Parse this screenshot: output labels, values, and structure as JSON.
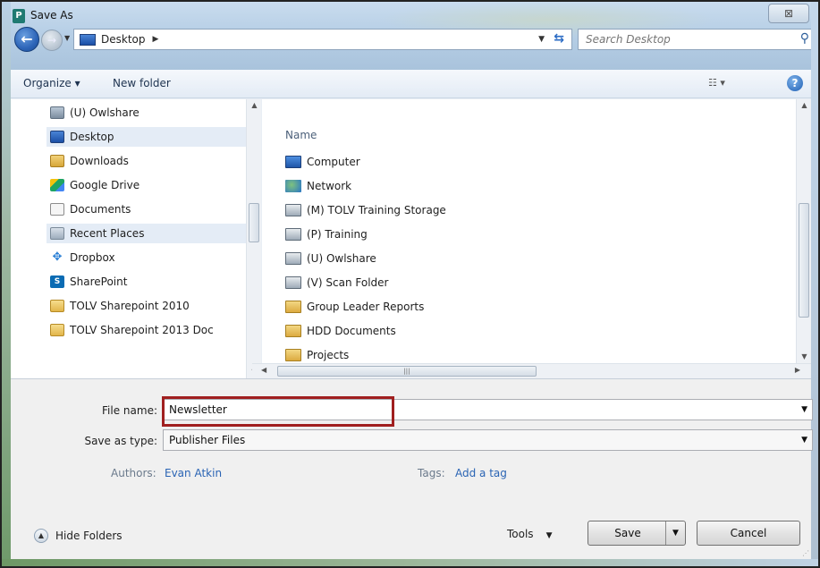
{
  "window": {
    "title": "Save As",
    "app_icon": "publisher-icon",
    "close_glyph": "⊠"
  },
  "nav": {
    "location": "Desktop",
    "search_placeholder": "Search Desktop"
  },
  "toolbar": {
    "organize_label": "Organize ▾",
    "new_folder_label": "New folder",
    "views_glyph": "▾",
    "help_glyph": "?"
  },
  "sidebar": {
    "items": [
      {
        "label": "(U) Owlshare",
        "icon": "network-drive-icon"
      },
      {
        "label": "Desktop",
        "icon": "desktop-icon",
        "selected": true
      },
      {
        "label": "Downloads",
        "icon": "downloads-icon"
      },
      {
        "label": "Google Drive",
        "icon": "google-drive-icon"
      },
      {
        "label": "Documents",
        "icon": "documents-icon"
      },
      {
        "label": "Recent Places",
        "icon": "recent-places-icon"
      },
      {
        "label": "Dropbox",
        "icon": "dropbox-icon"
      },
      {
        "label": "SharePoint",
        "icon": "sharepoint-icon"
      },
      {
        "label": "TOLV Sharepoint 2010",
        "icon": "folder-icon"
      },
      {
        "label": "TOLV Sharepoint 2013 Doc",
        "icon": "folder-icon"
      }
    ]
  },
  "files": {
    "column_header": "Name",
    "items": [
      {
        "label": "Computer",
        "icon": "computer-icon"
      },
      {
        "label": "Network",
        "icon": "network-icon"
      },
      {
        "label": "(M) TOLV Training Storage",
        "icon": "network-drive-icon"
      },
      {
        "label": "(P) Training",
        "icon": "network-drive-icon"
      },
      {
        "label": "(U) Owlshare",
        "icon": "network-drive-icon"
      },
      {
        "label": "(V) Scan Folder",
        "icon": "network-drive-icon"
      },
      {
        "label": "Group Leader Reports",
        "icon": "shortcut-folder-icon"
      },
      {
        "label": "HDD Documents",
        "icon": "shortcut-folder-icon"
      },
      {
        "label": "Projects",
        "icon": "shortcut-folder-icon"
      }
    ]
  },
  "form": {
    "file_name_label": "File name:",
    "file_name_value": "Newsletter",
    "save_type_label": "Save as type:",
    "save_type_value": "Publisher Files",
    "authors_label": "Authors:",
    "authors_value": "Evan Atkin",
    "tags_label": "Tags:",
    "tags_value": "Add a tag"
  },
  "footer": {
    "hide_folders_label": "Hide Folders",
    "tools_label": "Tools",
    "save_label": "Save",
    "cancel_label": "Cancel"
  },
  "colors": {
    "highlight_box": "#a01f1f",
    "link": "#2a64b4",
    "selection": "#e4ecf6"
  }
}
